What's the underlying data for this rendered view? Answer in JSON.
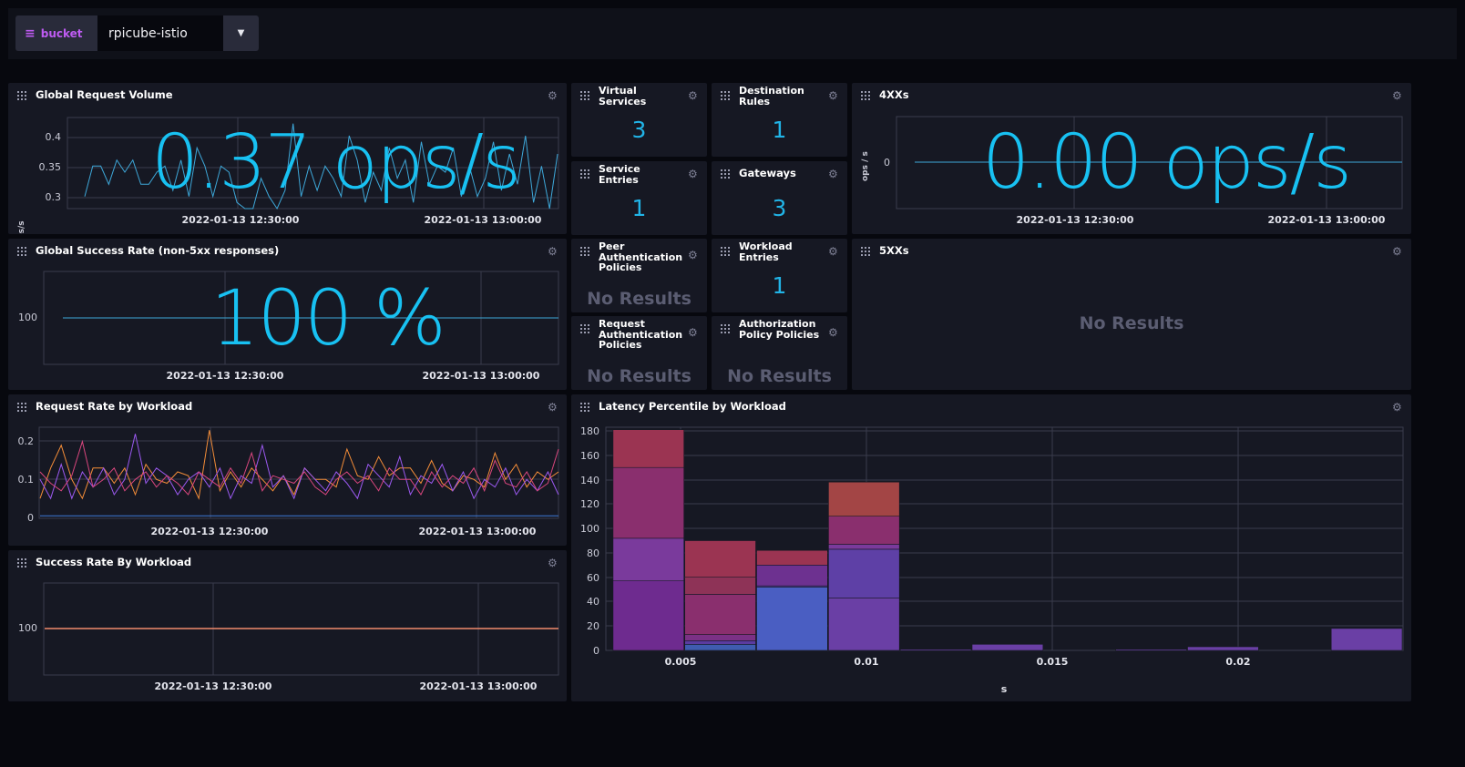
{
  "variable": {
    "name": "bucket",
    "value": "rpicube-istio"
  },
  "cells": {
    "global_request_volume": {
      "title": "Global Request Volume",
      "big_value": "0.37 ops/s",
      "ylabel": "ops/s",
      "yticks": [
        "0.4",
        "0.35",
        "0.3"
      ],
      "xticks": [
        "2022-01-13 12:30:00",
        "2022-01-13 13:00:00"
      ]
    },
    "global_success_rate": {
      "title": "Global Success Rate (non-5xx responses)",
      "big_value": "100 %",
      "yticks": [
        "100"
      ],
      "xticks": [
        "2022-01-13 12:30:00",
        "2022-01-13 13:00:00"
      ]
    },
    "request_rate_by_workload": {
      "title": "Request Rate by Workload",
      "yticks": [
        "0.2",
        "0.1",
        "0"
      ],
      "xticks": [
        "2022-01-13 12:30:00",
        "2022-01-13 13:00:00"
      ]
    },
    "success_rate_by_workload": {
      "title": "Success Rate By Workload",
      "yticks": [
        "100"
      ],
      "xticks": [
        "2022-01-13 12:30:00",
        "2022-01-13 13:00:00"
      ]
    },
    "virtual_services": {
      "title": "Virtual Services",
      "value": "3"
    },
    "destination_rules": {
      "title": "Destination Rules",
      "value": "1"
    },
    "service_entries": {
      "title": "Service Entries",
      "value": "1"
    },
    "gateways": {
      "title": "Gateways",
      "value": "3"
    },
    "peer_authentication_policies": {
      "title": "Peer Authentication Policies",
      "value": "No Results"
    },
    "workload_entries": {
      "title": "Workload Entries",
      "value": "1"
    },
    "request_authentication_policies": {
      "title": "Request Authentication Policies",
      "value": "No Results"
    },
    "authorization_policy_policies": {
      "title": "Authorization Policy Policies",
      "value": "No Results"
    },
    "fourxx": {
      "title": "4XXs",
      "big_value": "0.00 ops/s",
      "ylabel": "ops / s",
      "yticks": [
        "0"
      ],
      "xticks": [
        "2022-01-13 12:30:00",
        "2022-01-13 13:00:00"
      ]
    },
    "fivexx": {
      "title": "5XXs",
      "value": "No Results"
    },
    "latency_percentile_by_workload": {
      "title": "Latency Percentile by Workload",
      "yticks": [
        "180",
        "160",
        "140",
        "120",
        "100",
        "80",
        "60",
        "40",
        "20",
        "0"
      ],
      "xticks": [
        "0.005",
        "0.01",
        "0.015",
        "0.02"
      ],
      "xlabel": "s"
    }
  },
  "colors": {
    "accent": "#18c1f2",
    "background": "#07080e",
    "panel": "#161823",
    "no_results": "#5b5d72"
  },
  "chart_data": [
    {
      "type": "line",
      "title": "Global Request Volume",
      "ylabel": "ops/s",
      "ylim": [
        0.28,
        0.43
      ],
      "series": [
        {
          "values": [
            0.3,
            0.35,
            0.35,
            0.32,
            0.36,
            0.34,
            0.36,
            0.32,
            0.32,
            0.34,
            0.35,
            0.31,
            0.36,
            0.3,
            0.38,
            0.35,
            0.3,
            0.35,
            0.34,
            0.29,
            0.28,
            0.28,
            0.33,
            0.3,
            0.28,
            0.31,
            0.42,
            0.3,
            0.35,
            0.31,
            0.35,
            0.33,
            0.3,
            0.4,
            0.36,
            0.29,
            0.34,
            0.31,
            0.38,
            0.33,
            0.36,
            0.29,
            0.39,
            0.32,
            0.35,
            0.34,
            0.38,
            0.3,
            0.35,
            0.3,
            0.33,
            0.39,
            0.31,
            0.37,
            0.32,
            0.4,
            0.29,
            0.35,
            0.28,
            0.37
          ]
        }
      ]
    },
    {
      "type": "line",
      "title": "Global Success Rate (non-5xx responses)",
      "ylim": [
        0,
        200
      ],
      "series": [
        {
          "values": [
            100,
            100,
            100,
            100,
            100,
            100,
            100,
            100,
            100,
            100
          ]
        }
      ]
    },
    {
      "type": "line",
      "title": "Request Rate by Workload",
      "ylim": [
        0,
        0.24
      ],
      "series": [
        {
          "color": "#f48d38",
          "values": [
            0.05,
            0.13,
            0.19,
            0.1,
            0.05,
            0.13,
            0.13,
            0.09,
            0.13,
            0.06,
            0.14,
            0.1,
            0.09,
            0.12,
            0.11,
            0.05,
            0.23,
            0.07,
            0.12,
            0.08,
            0.13,
            0.1,
            0.07,
            0.11,
            0.06,
            0.13,
            0.1,
            0.1,
            0.08,
            0.18,
            0.11,
            0.1,
            0.16,
            0.11,
            0.13,
            0.13,
            0.09,
            0.15,
            0.09,
            0.07,
            0.11,
            0.1,
            0.08,
            0.17,
            0.1,
            0.14,
            0.08,
            0.12,
            0.1,
            0.12
          ]
        },
        {
          "color": "#9b59f0",
          "values": [
            0.1,
            0.05,
            0.14,
            0.05,
            0.12,
            0.08,
            0.13,
            0.06,
            0.1,
            0.22,
            0.09,
            0.13,
            0.11,
            0.06,
            0.1,
            0.12,
            0.08,
            0.13,
            0.05,
            0.11,
            0.09,
            0.19,
            0.08,
            0.11,
            0.05,
            0.13,
            0.1,
            0.07,
            0.12,
            0.09,
            0.05,
            0.14,
            0.11,
            0.08,
            0.16,
            0.06,
            0.11,
            0.09,
            0.14,
            0.07,
            0.12,
            0.05,
            0.1,
            0.08,
            0.13,
            0.06,
            0.1,
            0.07,
            0.12,
            0.06
          ]
        },
        {
          "color": "#d8467d",
          "values": [
            0.12,
            0.09,
            0.07,
            0.11,
            0.2,
            0.08,
            0.1,
            0.13,
            0.07,
            0.1,
            0.12,
            0.08,
            0.11,
            0.09,
            0.06,
            0.12,
            0.1,
            0.08,
            0.13,
            0.09,
            0.17,
            0.07,
            0.11,
            0.1,
            0.09,
            0.12,
            0.08,
            0.06,
            0.1,
            0.12,
            0.09,
            0.11,
            0.07,
            0.13,
            0.1,
            0.1,
            0.06,
            0.12,
            0.08,
            0.11,
            0.09,
            0.13,
            0.07,
            0.15,
            0.09,
            0.08,
            0.12,
            0.07,
            0.09,
            0.18
          ]
        },
        {
          "color": "#3f7bd8",
          "values": [
            0.004,
            0.004,
            0.004,
            0.004,
            0.004,
            0.004,
            0.004,
            0.004,
            0.004,
            0.004
          ]
        }
      ]
    },
    {
      "type": "line",
      "title": "Success Rate By Workload",
      "ylim": [
        0,
        200
      ],
      "series": [
        {
          "color": "#f08a6c",
          "values": [
            100,
            100,
            100,
            100,
            100,
            100,
            100,
            100,
            100,
            100
          ]
        }
      ]
    },
    {
      "type": "line",
      "title": "4XXs",
      "ylabel": "ops / s",
      "ylim": [
        -1,
        1
      ],
      "series": [
        {
          "values": [
            0,
            0,
            0,
            0,
            0,
            0,
            0,
            0,
            0,
            0
          ]
        }
      ]
    },
    {
      "type": "bar",
      "title": "Latency Percentile by Workload",
      "xlabel": "s",
      "ylim": [
        0,
        180
      ],
      "xlim": [
        0.0023,
        0.0245
      ],
      "bins": [
        {
          "x0": 0.0025,
          "x1": 0.0045,
          "segments": [
            [
              0,
              57,
              "#6e2b8f"
            ],
            [
              57,
              92,
              "#7a3a9c"
            ],
            [
              92,
              150,
              "#8a2f6e"
            ],
            [
              150,
              181,
              "#9b3452"
            ]
          ]
        },
        {
          "x0": 0.0045,
          "x1": 0.0065,
          "segments": [
            [
              0,
              5,
              "#3f5cb0"
            ],
            [
              5,
              8,
              "#5b3ba0"
            ],
            [
              8,
              13,
              "#7b3186"
            ],
            [
              13,
              46,
              "#8a2f6e"
            ],
            [
              46,
              60,
              "#8e3357"
            ],
            [
              60,
              90,
              "#9b3452"
            ]
          ]
        },
        {
          "x0": 0.0065,
          "x1": 0.0085,
          "segments": [
            [
              0,
              52,
              "#4a5ec2"
            ],
            [
              52,
              53,
              "#5b3ba0"
            ],
            [
              53,
              70,
              "#6d3190"
            ],
            [
              70,
              82,
              "#9b3452"
            ]
          ]
        },
        {
          "x0": 0.0085,
          "x1": 0.0105,
          "segments": [
            [
              0,
              43,
              "#6a3fa5"
            ],
            [
              43,
              83,
              "#5e40a6"
            ],
            [
              83,
              87,
              "#7a3a9c"
            ],
            [
              87,
              110,
              "#8a2f6e"
            ],
            [
              110,
              138,
              "#a34545"
            ]
          ]
        },
        {
          "x0": 0.0105,
          "x1": 0.0125,
          "segments": [
            [
              0,
              1,
              "#6a3fa5"
            ]
          ]
        },
        {
          "x0": 0.0125,
          "x1": 0.0145,
          "segments": [
            [
              0,
              5,
              "#6a3fa5"
            ]
          ]
        },
        {
          "x0": 0.0165,
          "x1": 0.0185,
          "segments": [
            [
              0,
              1,
              "#6a3fa5"
            ]
          ]
        },
        {
          "x0": 0.0185,
          "x1": 0.0205,
          "segments": [
            [
              0,
              3,
              "#6a3fa5"
            ]
          ]
        },
        {
          "x0": 0.0225,
          "x1": 0.0245,
          "segments": [
            [
              0,
              18,
              "#6a3fa5"
            ]
          ]
        }
      ]
    }
  ]
}
